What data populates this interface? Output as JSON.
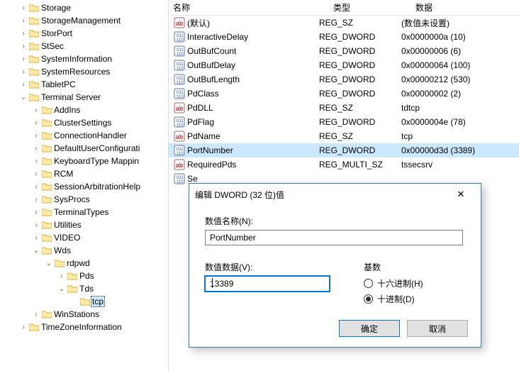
{
  "columns": {
    "name": "名称",
    "type": "类型",
    "data": "数据"
  },
  "tree": [
    {
      "depth": 1,
      "exp": ">",
      "label": "Storage"
    },
    {
      "depth": 1,
      "exp": ">",
      "label": "StorageManagement"
    },
    {
      "depth": 1,
      "exp": ">",
      "label": "StorPort"
    },
    {
      "depth": 1,
      "exp": ">",
      "label": "StSec"
    },
    {
      "depth": 1,
      "exp": ">",
      "label": "SystemInformation"
    },
    {
      "depth": 1,
      "exp": ">",
      "label": "SystemResources"
    },
    {
      "depth": 1,
      "exp": ">",
      "label": "TabletPC"
    },
    {
      "depth": 1,
      "exp": "v",
      "label": "Terminal Server"
    },
    {
      "depth": 2,
      "exp": ">",
      "label": "AddIns"
    },
    {
      "depth": 2,
      "exp": ">",
      "label": "ClusterSettings"
    },
    {
      "depth": 2,
      "exp": ">",
      "label": "ConnectionHandler"
    },
    {
      "depth": 2,
      "exp": ">",
      "label": "DefaultUserConfigurati"
    },
    {
      "depth": 2,
      "exp": ">",
      "label": "KeyboardType Mappin"
    },
    {
      "depth": 2,
      "exp": ">",
      "label": "RCM"
    },
    {
      "depth": 2,
      "exp": ">",
      "label": "SessionArbitrationHelp"
    },
    {
      "depth": 2,
      "exp": ">",
      "label": "SysProcs"
    },
    {
      "depth": 2,
      "exp": ">",
      "label": "TerminalTypes"
    },
    {
      "depth": 2,
      "exp": ">",
      "label": "Utilities"
    },
    {
      "depth": 2,
      "exp": ">",
      "label": "VIDEO"
    },
    {
      "depth": 2,
      "exp": "v",
      "label": "Wds"
    },
    {
      "depth": 3,
      "exp": "v",
      "label": "rdpwd"
    },
    {
      "depth": 4,
      "exp": ">",
      "label": "Pds"
    },
    {
      "depth": 4,
      "exp": "v",
      "label": "Tds"
    },
    {
      "depth": 5,
      "exp": "",
      "label": "tcp",
      "selected": true
    },
    {
      "depth": 2,
      "exp": ">",
      "label": "WinStations"
    },
    {
      "depth": 1,
      "exp": ">",
      "label": "TimeZoneInformation"
    }
  ],
  "values": [
    {
      "icon": "sz",
      "name": "(默认)",
      "type": "REG_SZ",
      "data": "(数值未设置)"
    },
    {
      "icon": "num",
      "name": "InteractiveDelay",
      "type": "REG_DWORD",
      "data": "0x0000000a (10)"
    },
    {
      "icon": "num",
      "name": "OutBufCount",
      "type": "REG_DWORD",
      "data": "0x00000006 (6)"
    },
    {
      "icon": "num",
      "name": "OutBufDelay",
      "type": "REG_DWORD",
      "data": "0x00000064 (100)"
    },
    {
      "icon": "num",
      "name": "OutBufLength",
      "type": "REG_DWORD",
      "data": "0x00000212 (530)"
    },
    {
      "icon": "num",
      "name": "PdClass",
      "type": "REG_DWORD",
      "data": "0x00000002 (2)"
    },
    {
      "icon": "sz",
      "name": "PdDLL",
      "type": "REG_SZ",
      "data": "tdtcp"
    },
    {
      "icon": "num",
      "name": "PdFlag",
      "type": "REG_DWORD",
      "data": "0x0000004e (78)"
    },
    {
      "icon": "sz",
      "name": "PdName",
      "type": "REG_SZ",
      "data": "tcp"
    },
    {
      "icon": "num",
      "name": "PortNumber",
      "type": "REG_DWORD",
      "data": "0x00000d3d (3389)",
      "selected": true
    },
    {
      "icon": "sz",
      "name": "RequiredPds",
      "type": "REG_MULTI_SZ",
      "data": "tssecsrv"
    },
    {
      "icon": "num",
      "name": "Se",
      "type": "",
      "data": ""
    }
  ],
  "dialog": {
    "title": "编辑 DWORD (32 位)值",
    "name_label": "数值名称(N):",
    "name_value": "PortNumber",
    "data_label": "数值数据(V):",
    "data_value": "13389",
    "base_label": "基数",
    "radio_hex": "十六进制(H)",
    "radio_dec": "十进制(D)",
    "ok": "确定",
    "cancel": "取消"
  }
}
